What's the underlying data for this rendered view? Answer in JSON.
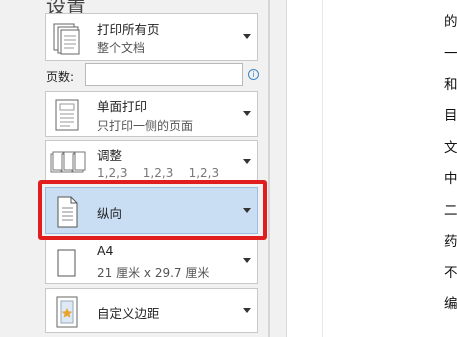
{
  "settings_title": "设置",
  "print_scope": {
    "main": "打印所有页",
    "sub": "整个文档"
  },
  "pages": {
    "label": "页数:",
    "value": "",
    "info": "i"
  },
  "sides": {
    "main": "单面打印",
    "sub": "只打印一侧的页面"
  },
  "collate": {
    "main": "调整",
    "sub": "1,2,3    1,2,3    1,2,3"
  },
  "orientation": {
    "main": "纵向"
  },
  "paper": {
    "main": "A4",
    "sub": "21 厘米 x 29.7 厘米"
  },
  "margins": {
    "main": "自定义边距"
  },
  "document_chars": [
    "的",
    "一",
    "和",
    "目",
    "文",
    "中",
    "二",
    "药",
    "不",
    "编"
  ]
}
